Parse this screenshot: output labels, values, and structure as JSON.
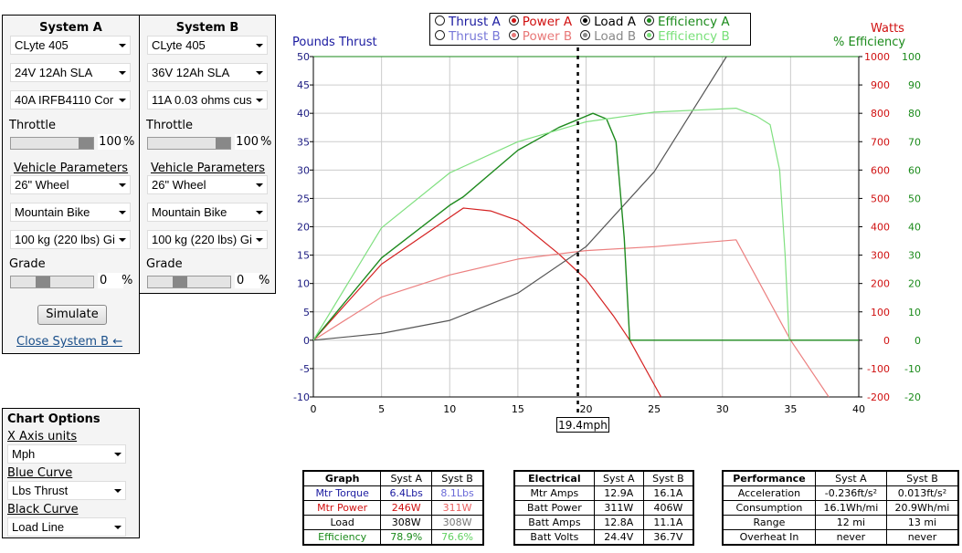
{
  "systemA": {
    "title": "System A",
    "motor": "CLyte 405",
    "battery": "24V 12Ah SLA",
    "controller": "40A IRFB4110 Cor",
    "throttle_label": "Throttle",
    "throttle_value": "100",
    "throttle_pct": 100,
    "vehicle_label": "Vehicle Parameters",
    "wheel": "26\"  Wheel",
    "bike": "Mountain Bike",
    "weight": "100 kg (220 lbs) Gi",
    "grade_label": "Grade",
    "grade_value": "0",
    "grade_slider_pct": 15,
    "pct": "%",
    "simulate": "Simulate",
    "close_link": "Close System B ←"
  },
  "systemB": {
    "title": "System B",
    "motor": "CLyte 405",
    "battery": "36V 12Ah SLA",
    "controller": "11A 0.03 ohms cus",
    "throttle_label": "Throttle",
    "throttle_value": "100",
    "throttle_pct": 100,
    "vehicle_label": "Vehicle Parameters",
    "wheel": "26\"  Wheel",
    "bike": "Mountain Bike",
    "weight": "100 kg (220 lbs) Gi",
    "grade_label": "Grade",
    "grade_value": "0",
    "grade_slider_pct": 15,
    "pct": "%"
  },
  "chart_options": {
    "title": "Chart Options",
    "x_axis_label": "X Axis units",
    "x_axis_value": "Mph",
    "blue_label": "Blue Curve",
    "blue_value": "Lbs Thrust",
    "black_label": "Black Curve",
    "black_value": "Load Line"
  },
  "legend": [
    [
      {
        "label": "Thrust A",
        "color": "#1a1aa0",
        "on": false
      },
      {
        "label": "Power A",
        "color": "#d01010",
        "on": true
      },
      {
        "label": "Load A",
        "color": "#000000",
        "on": true
      },
      {
        "label": "Efficiency A",
        "color": "#1a8a1a",
        "on": true
      }
    ],
    [
      {
        "label": "Thrust B",
        "color": "#7878d8",
        "on": false
      },
      {
        "label": "Power B",
        "color": "#e87878",
        "on": true
      },
      {
        "label": "Load B",
        "color": "#888888",
        "on": true
      },
      {
        "label": "Efficiency B",
        "color": "#78e078",
        "on": true
      }
    ]
  ],
  "chart_data": {
    "type": "line",
    "ylabel_left": "Pounds Thrust",
    "ylabel_right_1": "Watts",
    "ylabel_right_2": "% Efficiency",
    "xlim": [
      0,
      40
    ],
    "xticks": [
      0,
      5,
      10,
      15,
      20,
      25,
      30,
      35,
      40
    ],
    "ylim_left": [
      -10,
      50
    ],
    "yticks_left": [
      -10,
      -5,
      0,
      5,
      10,
      15,
      20,
      25,
      30,
      35,
      40,
      45,
      50
    ],
    "ylim_watts": [
      -200,
      1000
    ],
    "yticks_watts": [
      -200,
      -100,
      0,
      100,
      200,
      300,
      400,
      500,
      600,
      700,
      800,
      900,
      1000
    ],
    "ylim_eff": [
      -20,
      100
    ],
    "yticks_eff": [
      -20,
      -10,
      0,
      10,
      20,
      30,
      40,
      50,
      60,
      70,
      80,
      90,
      100
    ],
    "grid": true,
    "cursor": {
      "x": 19.4,
      "label": "19.4mph"
    },
    "series": [
      {
        "name": "Power A",
        "axis": "watts",
        "color": "#d42020",
        "points": [
          [
            0,
            0
          ],
          [
            5,
            268
          ],
          [
            11,
            466
          ],
          [
            13,
            456
          ],
          [
            15,
            422
          ],
          [
            18,
            304
          ],
          [
            20,
            214
          ],
          [
            22,
            86
          ],
          [
            23.2,
            0
          ],
          [
            25.5,
            -200
          ]
        ]
      },
      {
        "name": "Power B",
        "axis": "watts",
        "color": "#ec8080",
        "points": [
          [
            0,
            0
          ],
          [
            5,
            152
          ],
          [
            10,
            230
          ],
          [
            15,
            286
          ],
          [
            20,
            316
          ],
          [
            25,
            330
          ],
          [
            31,
            354
          ],
          [
            35,
            0
          ],
          [
            37.8,
            -200
          ]
        ]
      },
      {
        "name": "Load A",
        "axis": "left",
        "color": "#555555",
        "points": [
          [
            0,
            0
          ],
          [
            5,
            1.2
          ],
          [
            10,
            3.5
          ],
          [
            15,
            8.3
          ],
          [
            20,
            16.5
          ],
          [
            25,
            29.7
          ],
          [
            30.3,
            50
          ]
        ]
      },
      {
        "name": "Efficiency A",
        "axis": "eff",
        "color": "#1e8a1e",
        "points": [
          [
            0,
            0
          ],
          [
            5,
            29
          ],
          [
            10,
            47.6
          ],
          [
            11,
            50.6
          ],
          [
            15,
            67
          ],
          [
            18,
            75
          ],
          [
            20.5,
            80
          ],
          [
            21.5,
            78
          ],
          [
            22.2,
            70
          ],
          [
            22.8,
            36
          ],
          [
            23.2,
            0
          ],
          [
            40,
            0
          ]
        ]
      },
      {
        "name": "Efficiency B",
        "axis": "eff",
        "color": "#80e080",
        "points": [
          [
            0,
            0
          ],
          [
            5,
            39.6
          ],
          [
            10,
            59
          ],
          [
            15,
            70
          ],
          [
            20,
            77
          ],
          [
            25,
            80.4
          ],
          [
            31,
            81.8
          ],
          [
            32.5,
            79
          ],
          [
            33.5,
            76
          ],
          [
            34.2,
            60
          ],
          [
            34.6,
            30
          ],
          [
            34.9,
            0
          ]
        ]
      }
    ]
  },
  "tables": {
    "graph": {
      "header": [
        "Graph",
        "Syst A",
        "Syst B"
      ],
      "rows": [
        {
          "cells": [
            "Mtr Torque",
            "6.4Lbs",
            "8.1Lbs"
          ],
          "colors": [
            "#1a1aa0",
            "#1a1aa0",
            "#6a6ad8"
          ]
        },
        {
          "cells": [
            "Mtr Power",
            "246W",
            "311W"
          ],
          "colors": [
            "#d01010",
            "#d01010",
            "#e86060"
          ]
        },
        {
          "cells": [
            "Load",
            "308W",
            "308W"
          ],
          "colors": [
            "#000000",
            "#000000",
            "#777777"
          ]
        },
        {
          "cells": [
            "Efficiency",
            "78.9%",
            "76.6%"
          ],
          "colors": [
            "#1a8a1a",
            "#1a8a1a",
            "#60d060"
          ]
        }
      ]
    },
    "electrical": {
      "header": [
        "Electrical",
        "Syst A",
        "Syst B"
      ],
      "rows": [
        {
          "cells": [
            "Mtr Amps",
            "12.9A",
            "16.1A"
          ]
        },
        {
          "cells": [
            "Batt Power",
            "311W",
            "406W"
          ]
        },
        {
          "cells": [
            "Batt Amps",
            "12.8A",
            "11.1A"
          ]
        },
        {
          "cells": [
            "Batt Volts",
            "24.4V",
            "36.7V"
          ]
        }
      ]
    },
    "performance": {
      "header": [
        "Performance",
        "Syst A",
        "Syst B"
      ],
      "rows": [
        {
          "cells": [
            "Acceleration",
            "-0.236ft/s²",
            "0.013ft/s²"
          ]
        },
        {
          "cells": [
            "Consumption",
            "16.1Wh/mi",
            "20.9Wh/mi"
          ]
        },
        {
          "cells": [
            "Range",
            "12 mi",
            "13 mi"
          ]
        },
        {
          "cells": [
            "Overheat In",
            "never",
            "never"
          ]
        }
      ]
    }
  }
}
